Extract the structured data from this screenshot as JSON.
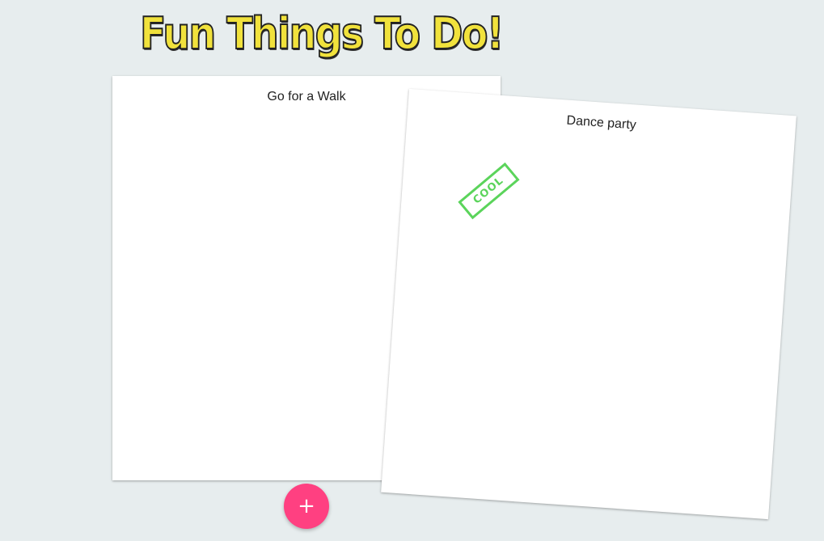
{
  "header": {
    "title": "Fun Things To Do!"
  },
  "cards": [
    {
      "title": "Go for a Walk"
    },
    {
      "title": "Dance party",
      "stamp": "COOL"
    }
  ],
  "fab": {
    "label": "+",
    "icon": "plus-icon",
    "color": "#ff4081"
  },
  "colors": {
    "background": "#e7edee",
    "title": "#f1e23c",
    "stamp": "#5bd45b"
  }
}
